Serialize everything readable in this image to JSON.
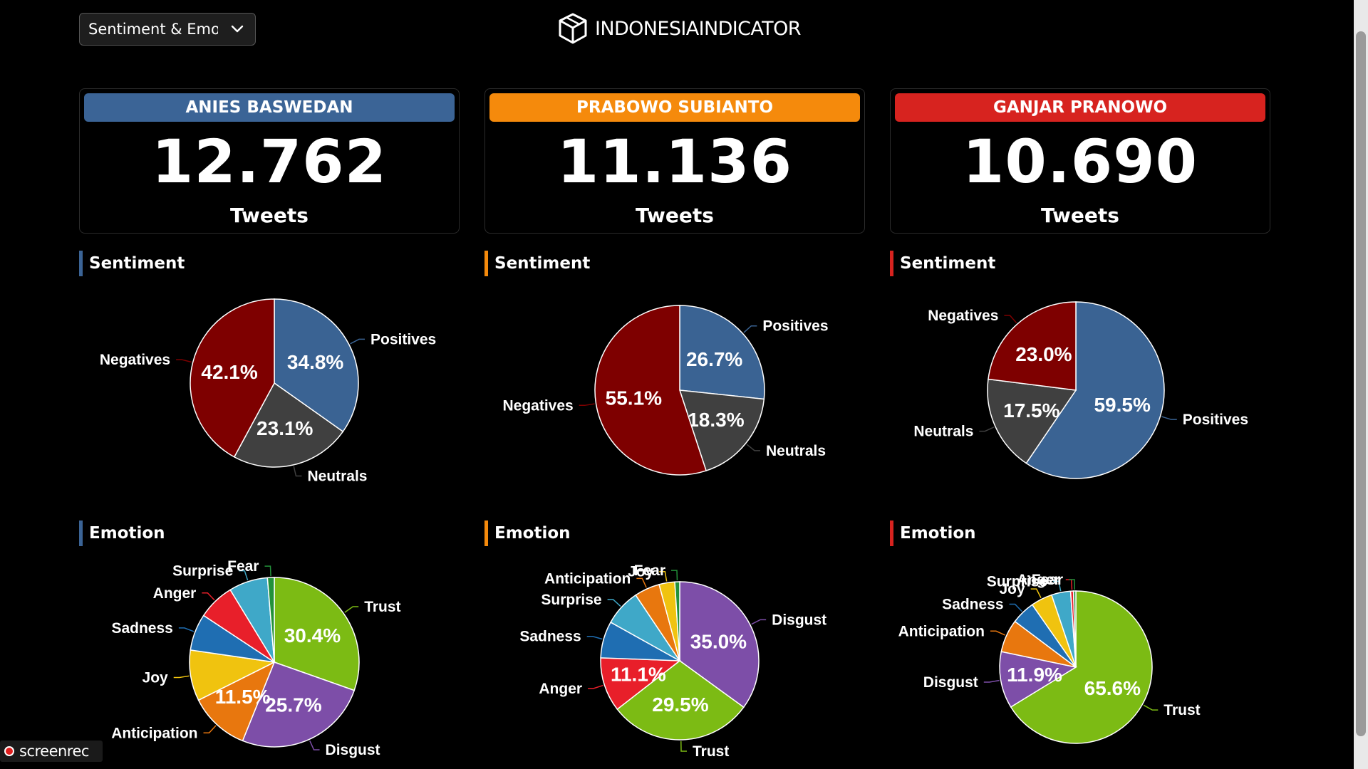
{
  "dropdown": {
    "value": "Sentiment & Emotion"
  },
  "logo": {
    "text": "INDONESIAINDICATOR"
  },
  "candidates": [
    {
      "name": "ANIES BASWEDAN",
      "count": "12.762",
      "unit": "Tweets",
      "color": "#3b6496"
    },
    {
      "name": "PRABOWO SUBIANTO",
      "count": "11.136",
      "unit": "Tweets",
      "color": "#f58a0c"
    },
    {
      "name": "GANJAR PRANOWO",
      "count": "10.690",
      "unit": "Tweets",
      "color": "#d7231f"
    }
  ],
  "sections": {
    "sentiment": "Sentiment",
    "emotion": "Emotion"
  },
  "colors": {
    "Positives": "#3a6393",
    "Negatives": "#7e0000",
    "Neutrals": "#404040",
    "Trust": "#7cbb14",
    "Disgust": "#7d4ea8",
    "Anticipation": "#e8770e",
    "Joy": "#f0c30f",
    "Sadness": "#1f6eb2",
    "Anger": "#e81f2a",
    "Surprise": "#3fa8c8",
    "Fear": "#23913a"
  },
  "chart_data": [
    {
      "type": "pie",
      "title": "Sentiment",
      "candidate": "ANIES BASWEDAN",
      "slices": [
        {
          "label": "Positives",
          "value": 34.8
        },
        {
          "label": "Neutrals",
          "value": 23.1
        },
        {
          "label": "Negatives",
          "value": 42.1
        }
      ]
    },
    {
      "type": "pie",
      "title": "Sentiment",
      "candidate": "PRABOWO SUBIANTO",
      "slices": [
        {
          "label": "Positives",
          "value": 26.7
        },
        {
          "label": "Neutrals",
          "value": 18.3
        },
        {
          "label": "Negatives",
          "value": 55.1
        }
      ]
    },
    {
      "type": "pie",
      "title": "Sentiment",
      "candidate": "GANJAR PRANOWO",
      "slices": [
        {
          "label": "Positives",
          "value": 59.5
        },
        {
          "label": "Neutrals",
          "value": 17.5
        },
        {
          "label": "Negatives",
          "value": 23.0
        }
      ]
    },
    {
      "type": "pie",
      "title": "Emotion",
      "candidate": "ANIES BASWEDAN",
      "slices": [
        {
          "label": "Trust",
          "value": 30.4
        },
        {
          "label": "Disgust",
          "value": 25.7
        },
        {
          "label": "Anticipation",
          "value": 11.5
        },
        {
          "label": "Joy",
          "value": 9.7
        },
        {
          "label": "Sadness",
          "value": 7.0
        },
        {
          "label": "Anger",
          "value": 7.0
        },
        {
          "label": "Surprise",
          "value": 7.4
        },
        {
          "label": "Fear",
          "value": 1.3
        }
      ]
    },
    {
      "type": "pie",
      "title": "Emotion",
      "candidate": "PRABOWO SUBIANTO",
      "slices": [
        {
          "label": "Disgust",
          "value": 35.0
        },
        {
          "label": "Trust",
          "value": 29.5
        },
        {
          "label": "Anger",
          "value": 11.1
        },
        {
          "label": "Sadness",
          "value": 7.5
        },
        {
          "label": "Surprise",
          "value": 7.5
        },
        {
          "label": "Anticipation",
          "value": 5.2
        },
        {
          "label": "Joy",
          "value": 3.2
        },
        {
          "label": "Fear",
          "value": 1.0
        }
      ]
    },
    {
      "type": "pie",
      "title": "Emotion",
      "candidate": "GANJAR PRANOWO",
      "slices": [
        {
          "label": "Trust",
          "value": 65.6
        },
        {
          "label": "Disgust",
          "value": 11.9
        },
        {
          "label": "Anticipation",
          "value": 6.9
        },
        {
          "label": "Sadness",
          "value": 5.0
        },
        {
          "label": "Joy",
          "value": 4.5
        },
        {
          "label": "Surprise",
          "value": 4.0
        },
        {
          "label": "Anger",
          "value": 0.6
        },
        {
          "label": "Fear",
          "value": 0.5
        }
      ]
    }
  ]
}
